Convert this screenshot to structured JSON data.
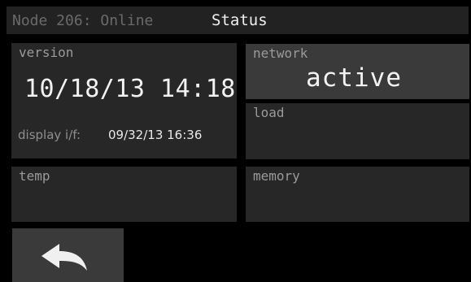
{
  "header": {
    "node_status": "Node 206: Online",
    "title": "Status"
  },
  "panels": {
    "version": {
      "label": "version",
      "value": "10/18/13 14:18",
      "display_if_label": "display i/f:",
      "display_if_value": "09/32/13 16:36"
    },
    "network": {
      "label": "network",
      "value": "active"
    },
    "load": {
      "label": "load"
    },
    "temp": {
      "label": "temp"
    },
    "memory": {
      "label": "memory"
    }
  },
  "back_button": {
    "icon": "back-arrow-icon"
  },
  "colors": {
    "background": "#000000",
    "header": "#222222",
    "panel": "#272727",
    "panel_highlight": "#3a3a3a",
    "label_text": "#9a9a9a",
    "value_text": "#f2f2f2"
  }
}
